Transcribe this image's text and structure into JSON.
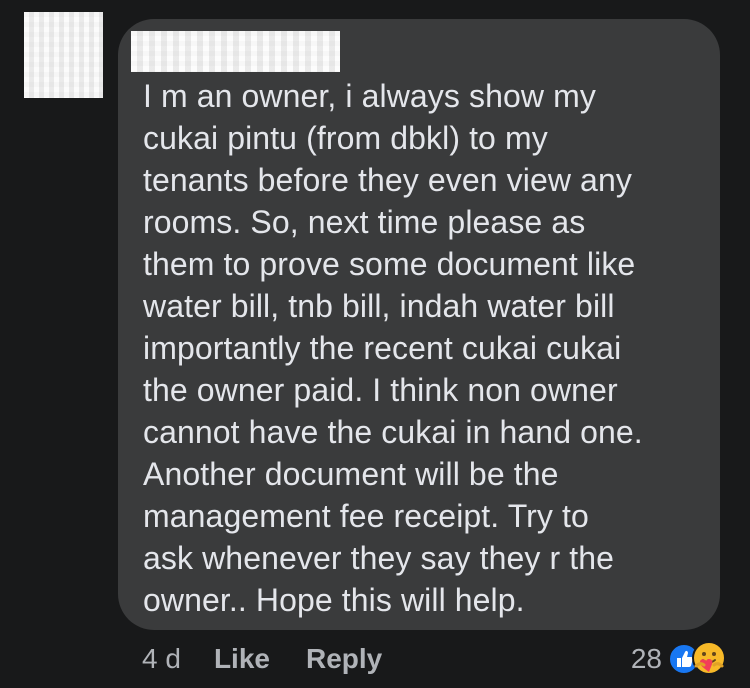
{
  "comment": {
    "lines": [
      "I m an owner, i always show my",
      "cukai pintu (from dbkl) to my",
      "tenants before they even view any",
      "rooms. So, next time please as",
      "them to prove some document like",
      "water bill, tnb bill, indah water bill",
      "importantly the recent cukai cukai",
      "the owner paid. I think non owner",
      "cannot have the cukai in hand one.",
      "Another document will be the",
      "management fee receipt. Try to",
      "ask whenever they say they r the",
      "owner.. Hope this will help."
    ]
  },
  "actions": {
    "timestamp": "4 d",
    "like_label": "Like",
    "reply_label": "Reply"
  },
  "reactions": {
    "count": "28",
    "icons": [
      "like-icon",
      "care-icon"
    ]
  },
  "colors": {
    "background": "#18191a",
    "bubble": "#3a3b3c",
    "text": "#e4e6eb",
    "secondary_text": "#b0b3b8",
    "like_blue": "#1877f2",
    "care_yellow": "#f7b928"
  }
}
